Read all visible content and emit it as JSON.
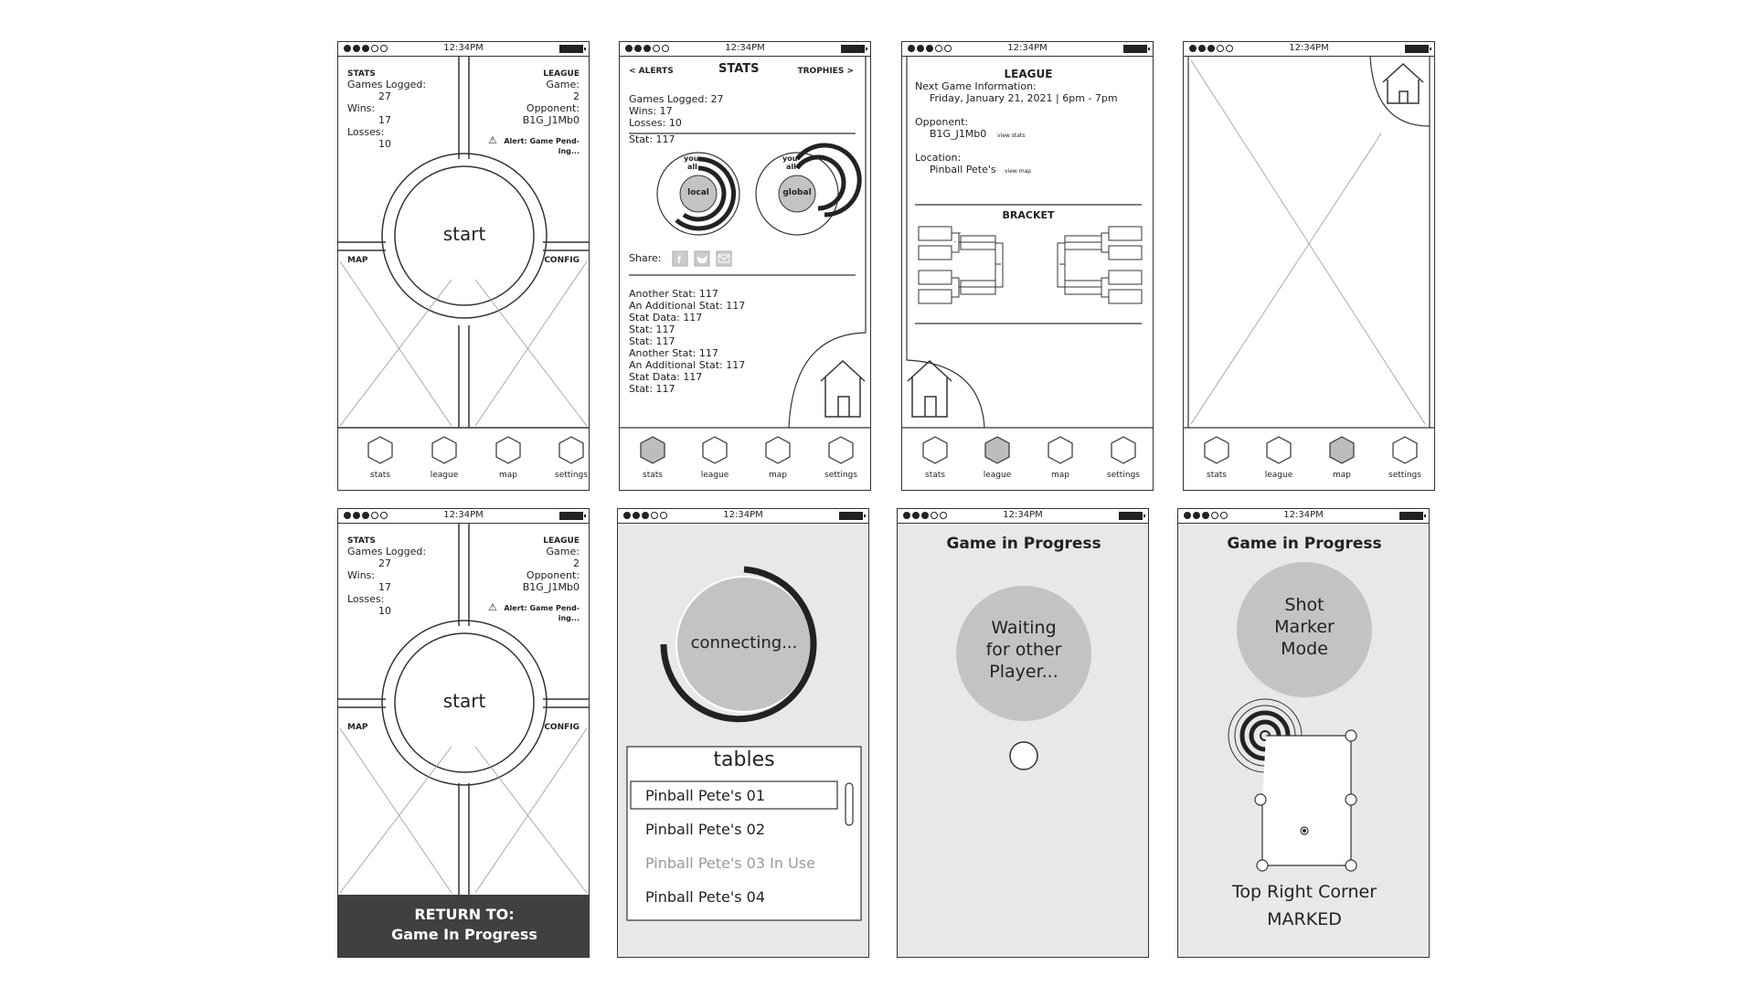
{
  "status_bar": {
    "time": "12:34PM"
  },
  "nav": {
    "stats": "stats",
    "league": "league",
    "map": "map",
    "settings": "settings"
  },
  "home_screen": {
    "stats_title": "STATS",
    "games_logged_label": "Games Logged:",
    "games_logged_value": "27",
    "wins_label": "Wins:",
    "wins_value": "17",
    "losses_label": "Losses:",
    "losses_value": "10",
    "league_title": "LEAGUE",
    "game_label": "Game:",
    "game_value": "2",
    "opponent_label": "Opponent:",
    "opponent_value": "B1G_J1Mb0",
    "alert_line1": "Alert: Game Pend-",
    "alert_line2": "ing...",
    "start": "start",
    "map_label": "MAP",
    "config_label": "CONFIG",
    "return_line1": "RETURN TO:",
    "return_line2": "Game In Progress"
  },
  "stats_screen": {
    "alerts": "< ALERTS",
    "title": "STATS",
    "trophies": "TROPHIES >",
    "games_logged": "Games Logged: 27",
    "wins": "Wins: 17",
    "losses": "Losses: 10",
    "stat": "Stat: 117",
    "you": "you",
    "all": "all",
    "local": "local",
    "global": "global",
    "share": "Share:",
    "stat_list": [
      "Another Stat: 117",
      "An Additional Stat: 117",
      "Stat Data: 117",
      "Stat: 117",
      "Stat: 117",
      "Another Stat: 117",
      "An Additional Stat: 117",
      "Stat Data: 117",
      "Stat: 117"
    ]
  },
  "league_screen": {
    "title": "LEAGUE",
    "next_game_label": "Next Game Information:",
    "next_game_value": "Friday, January 21, 2021  |  6pm - 7pm",
    "opponent_label": "Opponent:",
    "opponent_value": "B1G_J1Mb0",
    "view_stats": "view stats",
    "location_label": "Location:",
    "location_value": "Pinball Pete's",
    "view_map": "view map",
    "bracket": "BRACKET"
  },
  "connecting_screen": {
    "connecting": "connecting...",
    "tables_title": "tables",
    "tables": [
      "Pinball Pete's 01",
      "Pinball Pete's 02",
      "Pinball Pete's 03 In Use",
      "Pinball Pete's 04"
    ]
  },
  "waiting_screen": {
    "title": "Game in Progress",
    "waiting_line1": "Waiting",
    "waiting_line2": "for other",
    "waiting_line3": "Player..."
  },
  "shot_screen": {
    "title": "Game in Progress",
    "mode_line1": "Shot",
    "mode_line2": "Marker",
    "mode_line3": "Mode",
    "corner_line1": "Top Right Corner",
    "corner_line2": "MARKED"
  },
  "icons": [
    "hexagon-icon",
    "home-icon",
    "facebook-icon",
    "twitter-icon",
    "mail-icon",
    "warning-icon",
    "target-icon"
  ],
  "colors": {
    "outline": "#333333",
    "screen_gray": "#e7e8ea",
    "circle_gray": "#c2c3c5",
    "dark_banner": "#404040",
    "selected_hex": "#bdbdbd"
  }
}
